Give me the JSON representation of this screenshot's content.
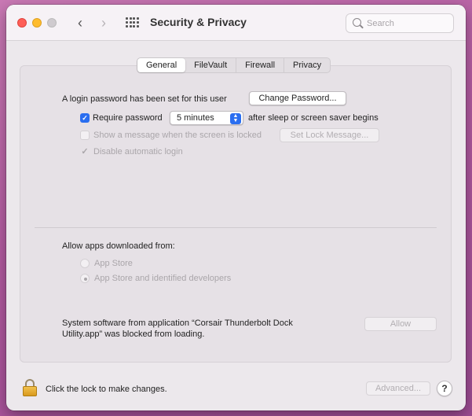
{
  "window": {
    "title": "Security & Privacy"
  },
  "search": {
    "placeholder": "Search"
  },
  "tabs": [
    {
      "label": "General",
      "active": true
    },
    {
      "label": "FileVault",
      "active": false
    },
    {
      "label": "Firewall",
      "active": false
    },
    {
      "label": "Privacy",
      "active": false
    }
  ],
  "general": {
    "login_password_text": "A login password has been set for this user",
    "change_password_label": "Change Password...",
    "require_password_label": "Require password",
    "require_password_checked": true,
    "require_password_delay": "5 minutes",
    "after_sleep_text": "after sleep or screen saver begins",
    "show_message_label": "Show a message when the screen is locked",
    "show_message_checked": false,
    "set_lock_message_label": "Set Lock Message...",
    "disable_auto_login_label": "Disable automatic login",
    "disable_auto_login_checked": true
  },
  "allow_apps": {
    "heading": "Allow apps downloaded from:",
    "options": [
      {
        "label": "App Store",
        "selected": false
      },
      {
        "label": "App Store and identified developers",
        "selected": true
      }
    ]
  },
  "blocked": {
    "line1": "System software from application “Corsair Thunderbolt Dock",
    "line2": "Utility.app” was blocked from loading.",
    "allow_label": "Allow"
  },
  "footer": {
    "lock_text": "Click the lock to make changes.",
    "advanced_label": "Advanced...",
    "help_label": "?"
  },
  "icons": {
    "check_glyph": "✓",
    "back_glyph": "‹",
    "forward_glyph": "›",
    "select_arrows_glyph": "▲▼"
  },
  "colors": {
    "accent": "#2a6ef0",
    "close": "#fe5f57",
    "minimize": "#febc2e",
    "zoom_disabled": "#cfcbcf"
  }
}
